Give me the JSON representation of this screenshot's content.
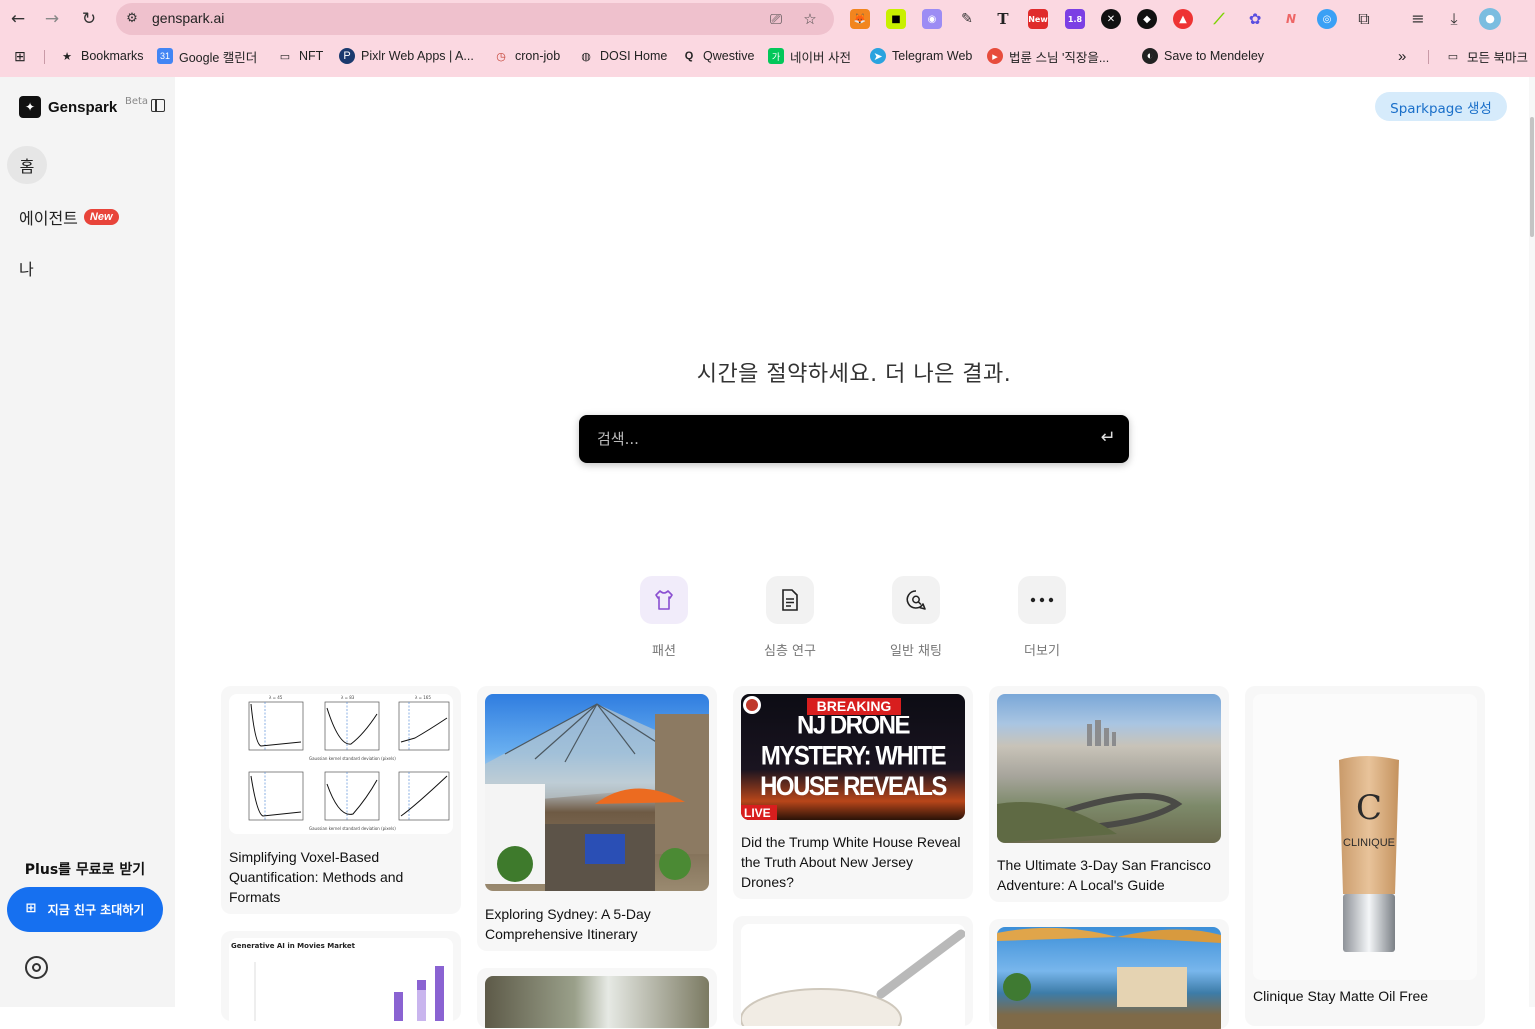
{
  "browser": {
    "url": "genspark.ai",
    "bookmarks": [
      {
        "label": "Bookmarks"
      },
      {
        "label": "Google 캘린더"
      },
      {
        "label": "NFT"
      },
      {
        "label": "Pixlr Web Apps | A..."
      },
      {
        "label": "cron-job"
      },
      {
        "label": "DOSI Home"
      },
      {
        "label": "Qwestive"
      },
      {
        "label": "네이버 사전"
      },
      {
        "label": "Telegram Web"
      },
      {
        "label": "법륜 스님 '직장을..."
      },
      {
        "label": "Save to Mendeley"
      }
    ],
    "all_bookmarks": "모든 북마크",
    "ext_badges": {
      "new": "New",
      "version": "1.8"
    }
  },
  "sidebar": {
    "brand": "Genspark",
    "beta": "Beta",
    "items": [
      {
        "label": "홈"
      },
      {
        "label": "에이전트",
        "badge": "New"
      },
      {
        "label": "나"
      }
    ],
    "plus_title": "Plus를 무료로 받기",
    "invite_label": "지금 친구 초대하기"
  },
  "header": {
    "sparkpage_label": "Sparkpage 생성"
  },
  "hero": {
    "title": "시간을 절약하세요. 더 나은 결과.",
    "search_placeholder": "검색..."
  },
  "quick_actions": [
    {
      "label": "패션",
      "icon": "shirt-icon"
    },
    {
      "label": "심층 연구",
      "icon": "document-icon"
    },
    {
      "label": "일반 채팅",
      "icon": "chat-search-icon"
    },
    {
      "label": "더보기",
      "icon": "more-icon"
    }
  ],
  "cards": [
    {
      "title": "Simplifying Voxel-Based Quantification: Methods and Formats"
    },
    {
      "title": "Exploring Sydney: A 5-Day Comprehensive Itinerary"
    },
    {
      "title": "Did the Trump White House Reveal the Truth About New Jersey Drones?"
    },
    {
      "title": "The Ultimate 3-Day San Francisco Adventure: A Local's Guide"
    },
    {
      "title": "Clinique Stay Matte Oil Free"
    }
  ],
  "thumbnail_text": {
    "drone_breaking": "BREAKING",
    "drone_headline": "NJ DRONE MYSTERY: WHITE HOUSE REVEALS THE TRUTH!",
    "drone_live": "LIVE",
    "gen_ai_title": "Generative AI in Movies Market",
    "clinique_brand": "CLINIQUE"
  },
  "colors": {
    "chrome_bg": "#fbd8e1",
    "accent_blue": "#1670f0",
    "new_badge": "#e8443a"
  }
}
